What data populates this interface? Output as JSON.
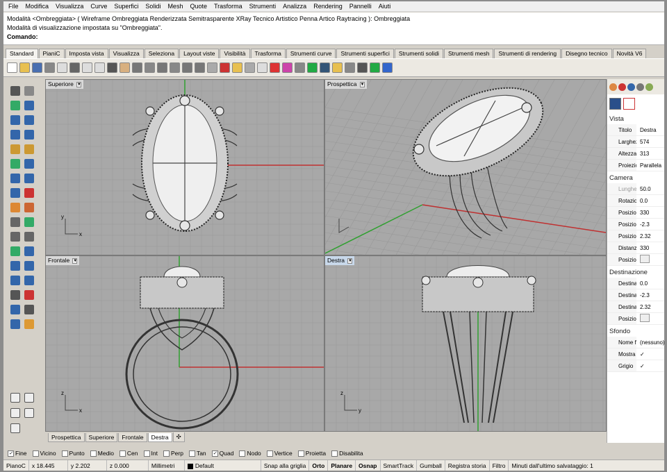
{
  "menu": [
    "File",
    "Modifica",
    "Visualizza",
    "Curve",
    "Superfici",
    "Solidi",
    "Mesh",
    "Quote",
    "Trasforma",
    "Strumenti",
    "Analizza",
    "Rendering",
    "Pannelli",
    "Aiuti"
  ],
  "command_history": {
    "line1": "Modalità <Ombreggiata> ( Wireframe  Ombreggiata  Renderizzata  Semitrasparente  XRay  Tecnico  Artistico  Penna  Artico  Raytracing ): Ombreggiata",
    "line2": "Modalità di visualizzazione impostata su \"Ombreggiata\".",
    "prompt": "Comando:"
  },
  "toolbar_tabs": [
    "Standard",
    "PianiC",
    "Imposta vista",
    "Visualizza",
    "Seleziona",
    "Layout viste",
    "Visibilità",
    "Trasforma",
    "Strumenti curve",
    "Strumenti superfici",
    "Strumenti solidi",
    "Strumenti mesh",
    "Strumenti di rendering",
    "Disegno tecnico",
    "Novità V6"
  ],
  "viewports": {
    "top": {
      "title": "Superiore",
      "axis_x": "x",
      "axis_y": "y"
    },
    "perspective": {
      "title": "Prospettica"
    },
    "front": {
      "title": "Frontale",
      "axis_x": "x",
      "axis_y": "z"
    },
    "right": {
      "title": "Destra",
      "axis_x": "y",
      "axis_y": "z"
    }
  },
  "viewport_tabs": [
    "Prospettica",
    "Superiore",
    "Frontale",
    "Destra"
  ],
  "properties": {
    "vista_title": "Vista",
    "vista": [
      {
        "key": "Titolo",
        "value": "Destra"
      },
      {
        "key": "Larghezza",
        "value": "574"
      },
      {
        "key": "Altezza",
        "value": "313"
      },
      {
        "key": "Proiezione",
        "value": "Parallela"
      }
    ],
    "camera_title": "Camera",
    "camera": [
      {
        "key": "Lunghezza focale",
        "value": "50.0"
      },
      {
        "key": "Rotazione",
        "value": "0.0"
      },
      {
        "key": "Posizione X",
        "value": "330"
      },
      {
        "key": "Posizione Y",
        "value": "-2.3"
      },
      {
        "key": "Posizione Z",
        "value": "2.32"
      },
      {
        "key": "Distanza di",
        "value": "330"
      }
    ],
    "posizione_label": "Posizione",
    "destinazione_title": "Destinazione",
    "destinazione": [
      {
        "key": "Destinazione",
        "value": "0.0"
      },
      {
        "key": "Destinazione",
        "value": "-2.3"
      },
      {
        "key": "Destinazione",
        "value": "2.32"
      }
    ],
    "sfondo_title": "Sfondo",
    "sfondo": [
      {
        "key": "Nome file",
        "value": "(nessuno)"
      },
      {
        "key": "Mostra",
        "value": "✓"
      },
      {
        "key": "Grigio",
        "value": "✓"
      }
    ]
  },
  "osnap": [
    {
      "label": "Fine",
      "checked": true
    },
    {
      "label": "Vicino",
      "checked": false
    },
    {
      "label": "Punto",
      "checked": false
    },
    {
      "label": "Medio",
      "checked": false
    },
    {
      "label": "Cen",
      "checked": false
    },
    {
      "label": "Int",
      "checked": false
    },
    {
      "label": "Perp",
      "checked": false
    },
    {
      "label": "Tan",
      "checked": false
    },
    {
      "label": "Quad",
      "checked": true
    },
    {
      "label": "Nodo",
      "checked": false
    },
    {
      "label": "Vertice",
      "checked": false
    },
    {
      "label": "Proietta",
      "checked": false
    },
    {
      "label": "Disabilita",
      "checked": false
    }
  ],
  "status": {
    "plane": "PianoC",
    "x": "x 18.445",
    "y": "y 2.202",
    "z": "z 0.000",
    "units": "Millimetri",
    "layer": "Default",
    "snap": "Snap alla griglia",
    "ortho": "Orto",
    "planar": "Planare",
    "osnap": "Osnap",
    "smarttrack": "SmartTrack",
    "gumball": "Gumball",
    "history": "Registra storia",
    "filter": "Filtro",
    "autosave": "Minuti dall'ultimo salvataggio: 1"
  },
  "colors": {
    "viewport_bg": "#a8a8a8",
    "grid_line": "#999999",
    "axis_x": "#c03030",
    "axis_y": "#30a030",
    "ring_fill": "#e8e8e8",
    "ring_stroke": "#333333"
  }
}
